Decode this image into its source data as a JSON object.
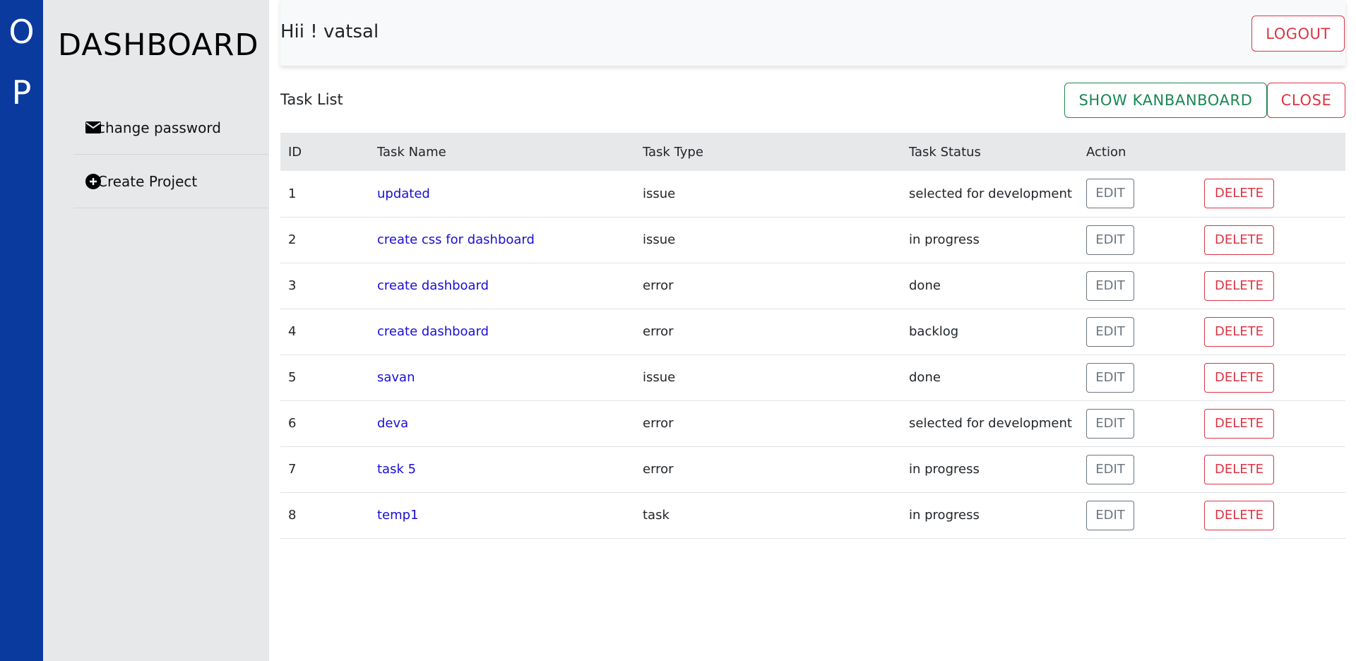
{
  "rail": {
    "letters": [
      "O",
      "P"
    ]
  },
  "sidebar": {
    "title": "DASHBOARD",
    "items": [
      {
        "label": "change password",
        "icon": "envelope-icon"
      },
      {
        "label": "Create Project",
        "icon": "plus-circle-icon"
      }
    ]
  },
  "header": {
    "greeting": "Hii ! vatsal",
    "logout_label": "LOGOUT"
  },
  "tasks": {
    "title": "Task List",
    "show_kanban_label": "SHOW KANBANBOARD",
    "close_label": "CLOSE",
    "columns": [
      "ID",
      "Task Name",
      "Task Type",
      "Task Status",
      "Action"
    ],
    "edit_label": "EDIT",
    "delete_label": "DELETE",
    "rows": [
      {
        "id": "1",
        "name": "updated",
        "type": "issue",
        "status": "selected for development"
      },
      {
        "id": "2",
        "name": "create css for dashboard",
        "type": "issue",
        "status": "in progress"
      },
      {
        "id": "3",
        "name": "create dashboard",
        "type": "error",
        "status": "done"
      },
      {
        "id": "4",
        "name": "create dashboard",
        "type": "error",
        "status": "backlog"
      },
      {
        "id": "5",
        "name": "savan",
        "type": "issue",
        "status": "done"
      },
      {
        "id": "6",
        "name": "deva",
        "type": "error",
        "status": "selected for development"
      },
      {
        "id": "7",
        "name": "task 5",
        "type": "error",
        "status": "in progress"
      },
      {
        "id": "8",
        "name": "temp1",
        "type": "task",
        "status": "in progress"
      }
    ]
  },
  "colors": {
    "rail": "#0a3a9e",
    "sidebar": "#e7e8ea",
    "link": "#1a0dd6",
    "danger": "#dc3545",
    "success": "#198754",
    "secondary": "#6c757d"
  }
}
